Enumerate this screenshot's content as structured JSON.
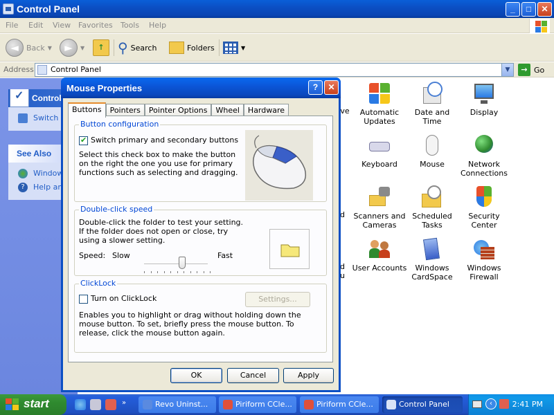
{
  "window": {
    "title": "Control Panel",
    "minimize": "_",
    "maximize": "□",
    "close": "✕"
  },
  "menu": [
    "File",
    "Edit",
    "View",
    "Favorites",
    "Tools",
    "Help"
  ],
  "toolbar": {
    "back": "Back",
    "search": "Search",
    "folders": "Folders"
  },
  "address": {
    "label": "Address",
    "value": "Control Panel",
    "go": "Go"
  },
  "left_pane": {
    "control_panel_head": "Control Panel",
    "switch_link": "Switch to Classic View",
    "see_also_head": "See Also",
    "see_also_links": [
      "Windows Update",
      "Help and Support"
    ]
  },
  "icons": [
    {
      "label": "Automatic Updates",
      "icon": "automatic-updates-icon"
    },
    {
      "label": "Date and Time",
      "icon": "date-time-icon"
    },
    {
      "label": "Display",
      "icon": "display-icon"
    },
    {
      "label": "Keyboard",
      "icon": "keyboard-icon"
    },
    {
      "label": "Mouse",
      "icon": "mouse-icon"
    },
    {
      "label": "Network Connections",
      "icon": "network-connections-icon"
    },
    {
      "label": "Scanners and Cameras",
      "icon": "scanners-cameras-icon"
    },
    {
      "label": "Scheduled Tasks",
      "icon": "scheduled-tasks-icon"
    },
    {
      "label": "Security Center",
      "icon": "security-center-icon"
    },
    {
      "label": "User Accounts",
      "icon": "user-accounts-icon"
    },
    {
      "label": "Windows CardSpace",
      "icon": "cardspace-icon"
    },
    {
      "label": "Windows Firewall",
      "icon": "firewall-icon"
    }
  ],
  "partial_labels": [
    "tive",
    "t",
    "nd",
    "nd nu"
  ],
  "dialog": {
    "title": "Mouse Properties",
    "help": "?",
    "close": "✕",
    "tabs": [
      "Buttons",
      "Pointers",
      "Pointer Options",
      "Wheel",
      "Hardware"
    ],
    "active_tab": "Buttons",
    "button_config": {
      "title": "Button configuration",
      "checkbox_label": "Switch primary and secondary buttons",
      "checked": true,
      "description": "Select this check box to make the button on the right the one you use for primary functions such as selecting and dragging."
    },
    "double_click": {
      "title": "Double-click speed",
      "description": "Double-click the folder to test your setting. If the folder does not open or close, try using a slower setting.",
      "speed_label": "Speed:",
      "slow": "Slow",
      "fast": "Fast",
      "speed_value": 0.6
    },
    "clicklock": {
      "title": "ClickLock",
      "checkbox_label": "Turn on ClickLock",
      "checked": false,
      "settings_button": "Settings...",
      "description": "Enables you to highlight or drag without holding down the mouse button. To set, briefly press the mouse button. To release, click the mouse button again."
    },
    "ok": "OK",
    "cancel": "Cancel",
    "apply": "Apply"
  },
  "taskbar": {
    "start": "start",
    "tasks": [
      {
        "label": "Revo Uninst...",
        "active": false
      },
      {
        "label": "Piriform CCle...",
        "active": false
      },
      {
        "label": "Piriform CCle...",
        "active": false
      },
      {
        "label": "Control Panel",
        "active": true
      }
    ],
    "clock": "2:41 PM"
  }
}
